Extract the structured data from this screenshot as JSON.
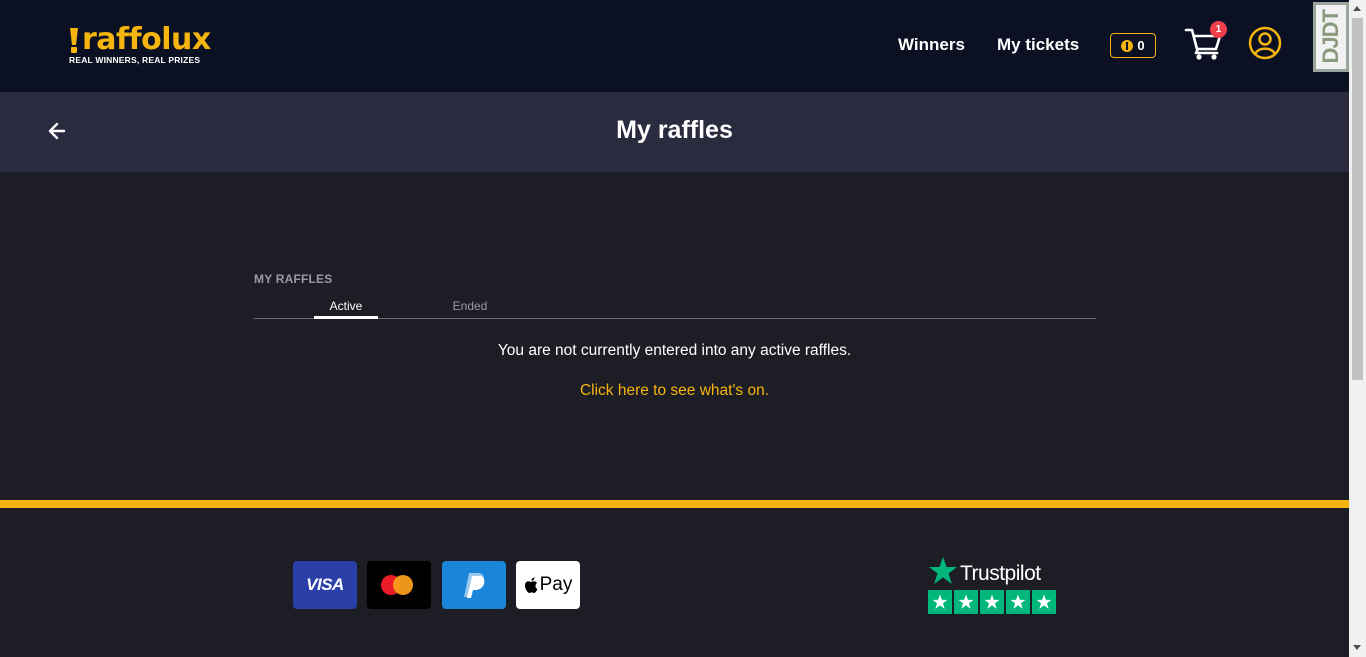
{
  "header": {
    "logo_text": "raffolux",
    "logo_tagline": "REAL WINNERS, REAL PRIZES",
    "nav": [
      {
        "label": "Winners"
      },
      {
        "label": "My tickets"
      }
    ],
    "coin_count": "0",
    "cart_count": "1",
    "devtools_label": "DJDT"
  },
  "subheader": {
    "title": "My raffles"
  },
  "main": {
    "section_label": "MY RAFFLES",
    "tabs": [
      {
        "label": "Active",
        "active": true
      },
      {
        "label": "Ended",
        "active": false
      }
    ],
    "empty_message": "You are not currently entered into any active raffles.",
    "cta_link": "Click here to see what's on."
  },
  "footer": {
    "payment_methods": [
      "VISA",
      "Mastercard",
      "PayPal",
      "Pay"
    ],
    "trustpilot_label": "Trustpilot",
    "trustpilot_stars": 5
  },
  "colors": {
    "brand_yellow": "#f6b40e",
    "header_bg": "#0b1023",
    "subheader_bg": "#2a2b3e",
    "page_bg": "#1d1d26",
    "badge_red": "#ef3f4a",
    "trustpilot_green": "#00b67a"
  }
}
